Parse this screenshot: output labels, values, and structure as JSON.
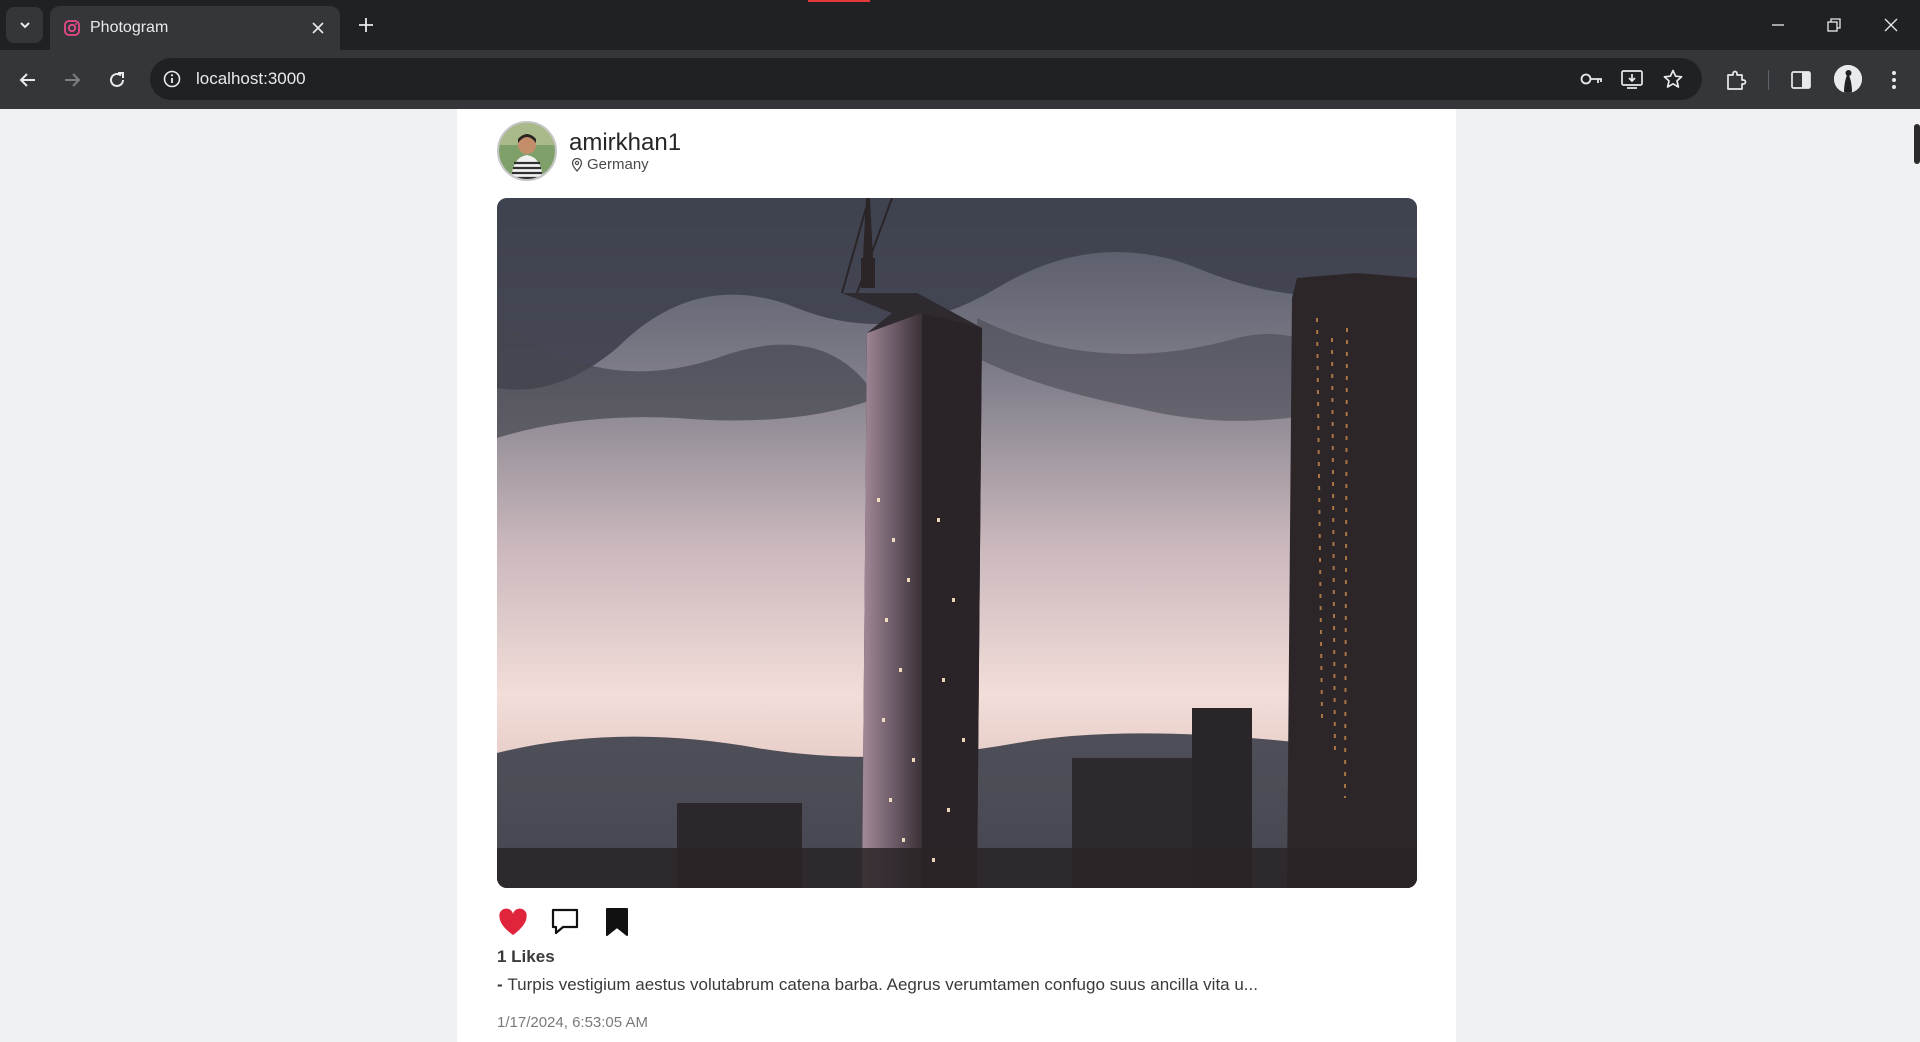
{
  "browser": {
    "tab_title": "Photogram",
    "url": "localhost:3000"
  },
  "post": {
    "username": "amirkhan1",
    "location": "Germany",
    "likes_text": "1 Likes",
    "caption_prefix": "- ",
    "caption_text": "Turpis vestigium aestus volutabrum catena barba. Aegrus verumtamen confugo suus ancilla vita u...",
    "timestamp": "1/17/2024, 6:53:05 AM",
    "liked": true
  },
  "colors": {
    "like_red": "#e0243c",
    "favicon": "#e84a8a",
    "chrome_dark": "#202124",
    "chrome_mid": "#35363a"
  },
  "icons": {
    "like": "heart-icon",
    "comment": "comment-icon",
    "save": "bookmark-icon",
    "location": "map-pin-icon"
  }
}
